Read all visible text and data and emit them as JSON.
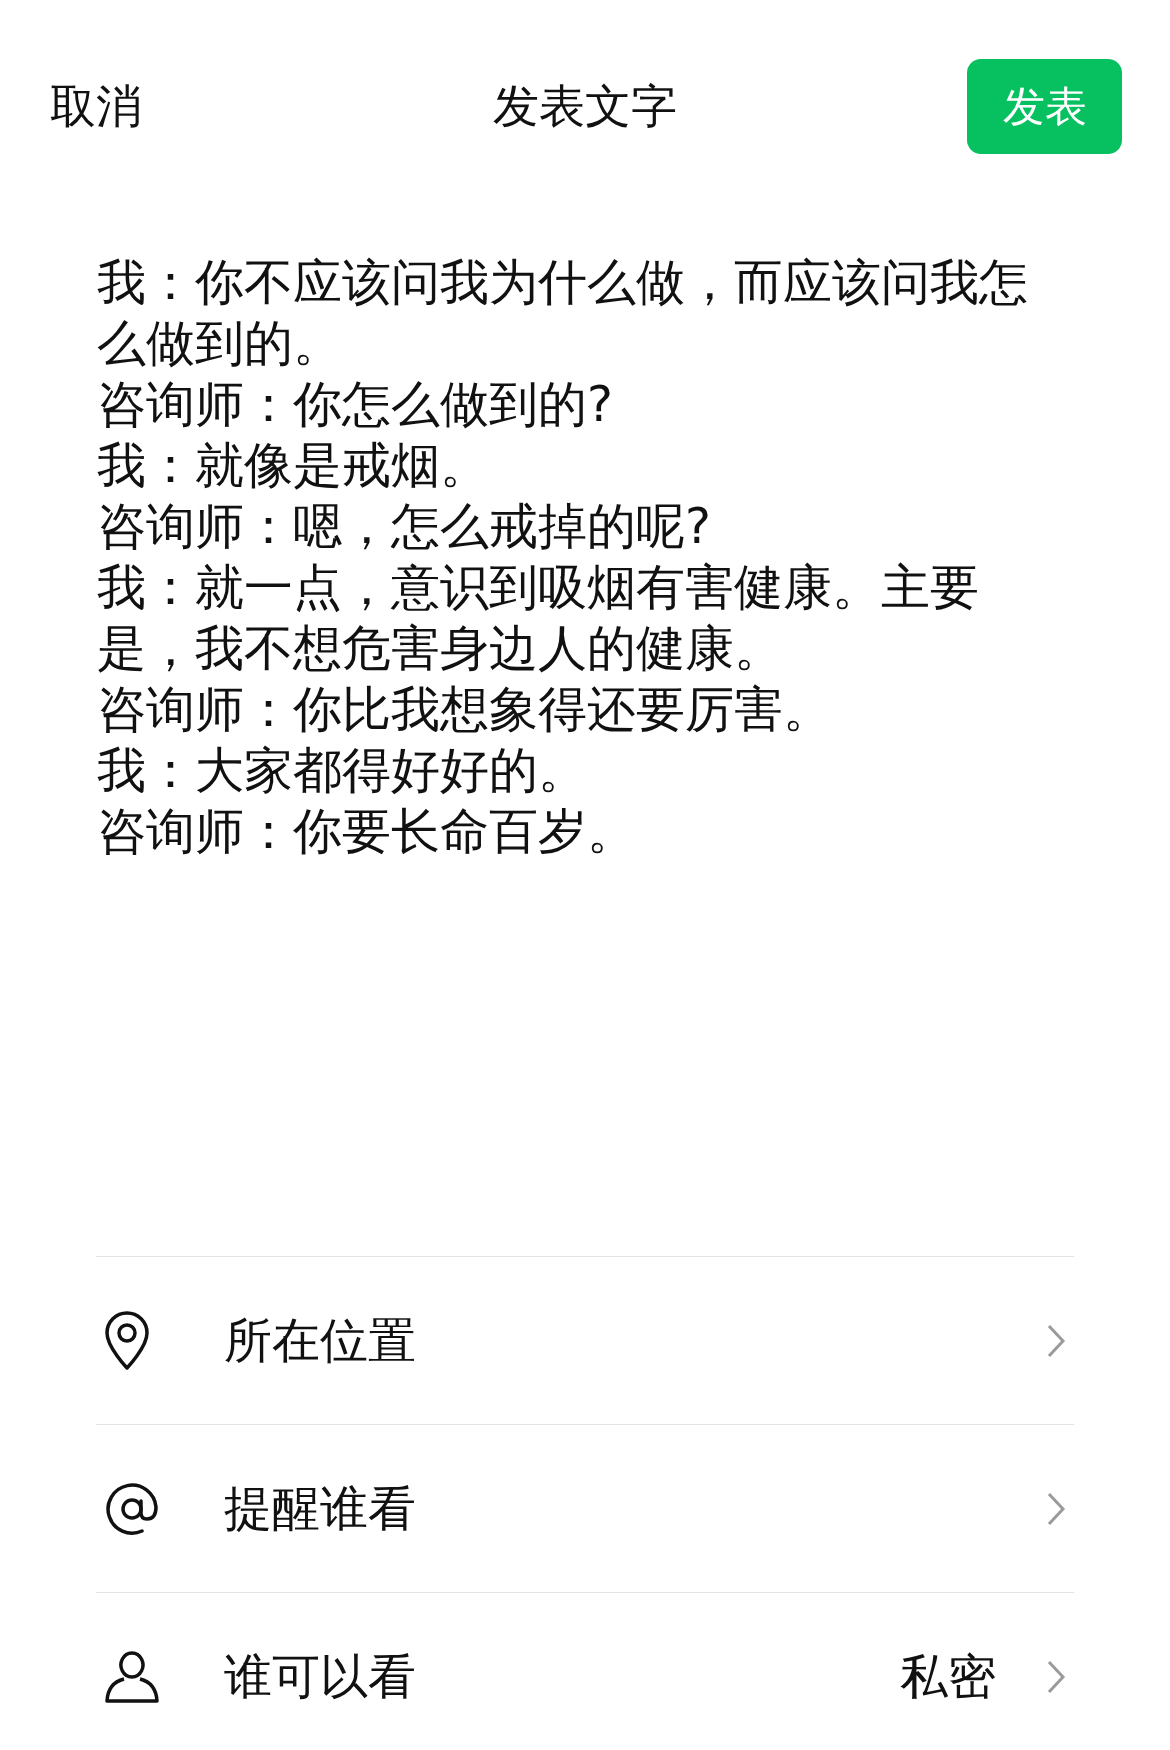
{
  "header": {
    "cancel": "取消",
    "title": "发表文字",
    "post_button": "发表"
  },
  "post": {
    "lines": [
      "我：你不应该问我为什么做，而应该问我怎么做到的。",
      "咨询师：你怎么做到的?",
      "我：就像是戒烟。",
      "咨询师：嗯，怎么戒掉的呢?",
      "我：就一点，意识到吸烟有害健康。主要是，我不想危害身边人的健康。",
      "咨询师：你比我想象得还要厉害。",
      "我：大家都得好好的。",
      "咨询师：你要长命百岁。"
    ]
  },
  "options": [
    {
      "kind": "location",
      "label": "所在位置"
    },
    {
      "kind": "mention",
      "label": "提醒谁看"
    },
    {
      "kind": "visibility",
      "label": "谁可以看",
      "value": "私密"
    }
  ]
}
